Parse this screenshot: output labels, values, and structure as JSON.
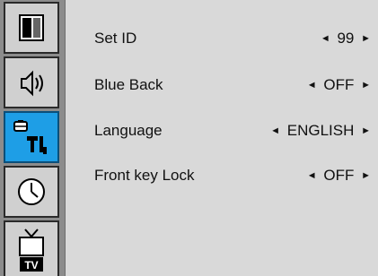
{
  "sidebar": {
    "items": [
      {
        "icon": "picture-icon",
        "active": false
      },
      {
        "icon": "sound-icon",
        "active": false
      },
      {
        "icon": "setup-tools-icon",
        "active": true
      },
      {
        "icon": "clock-icon",
        "active": false
      },
      {
        "icon": "tv-icon",
        "active": false,
        "label": "TV"
      }
    ]
  },
  "menu": {
    "rows": [
      {
        "label": "Set ID",
        "value": "99"
      },
      {
        "label": "Blue Back",
        "value": "OFF"
      },
      {
        "label": "Language",
        "value": "ENGLISH"
      },
      {
        "label": "Front key Lock",
        "value": "OFF"
      }
    ],
    "arrow_left": "◄",
    "arrow_right": "►"
  },
  "colors": {
    "panel": "#d9d9d9",
    "sidebar": "#8c8c8c",
    "active_tab": "#1e9ee6"
  }
}
